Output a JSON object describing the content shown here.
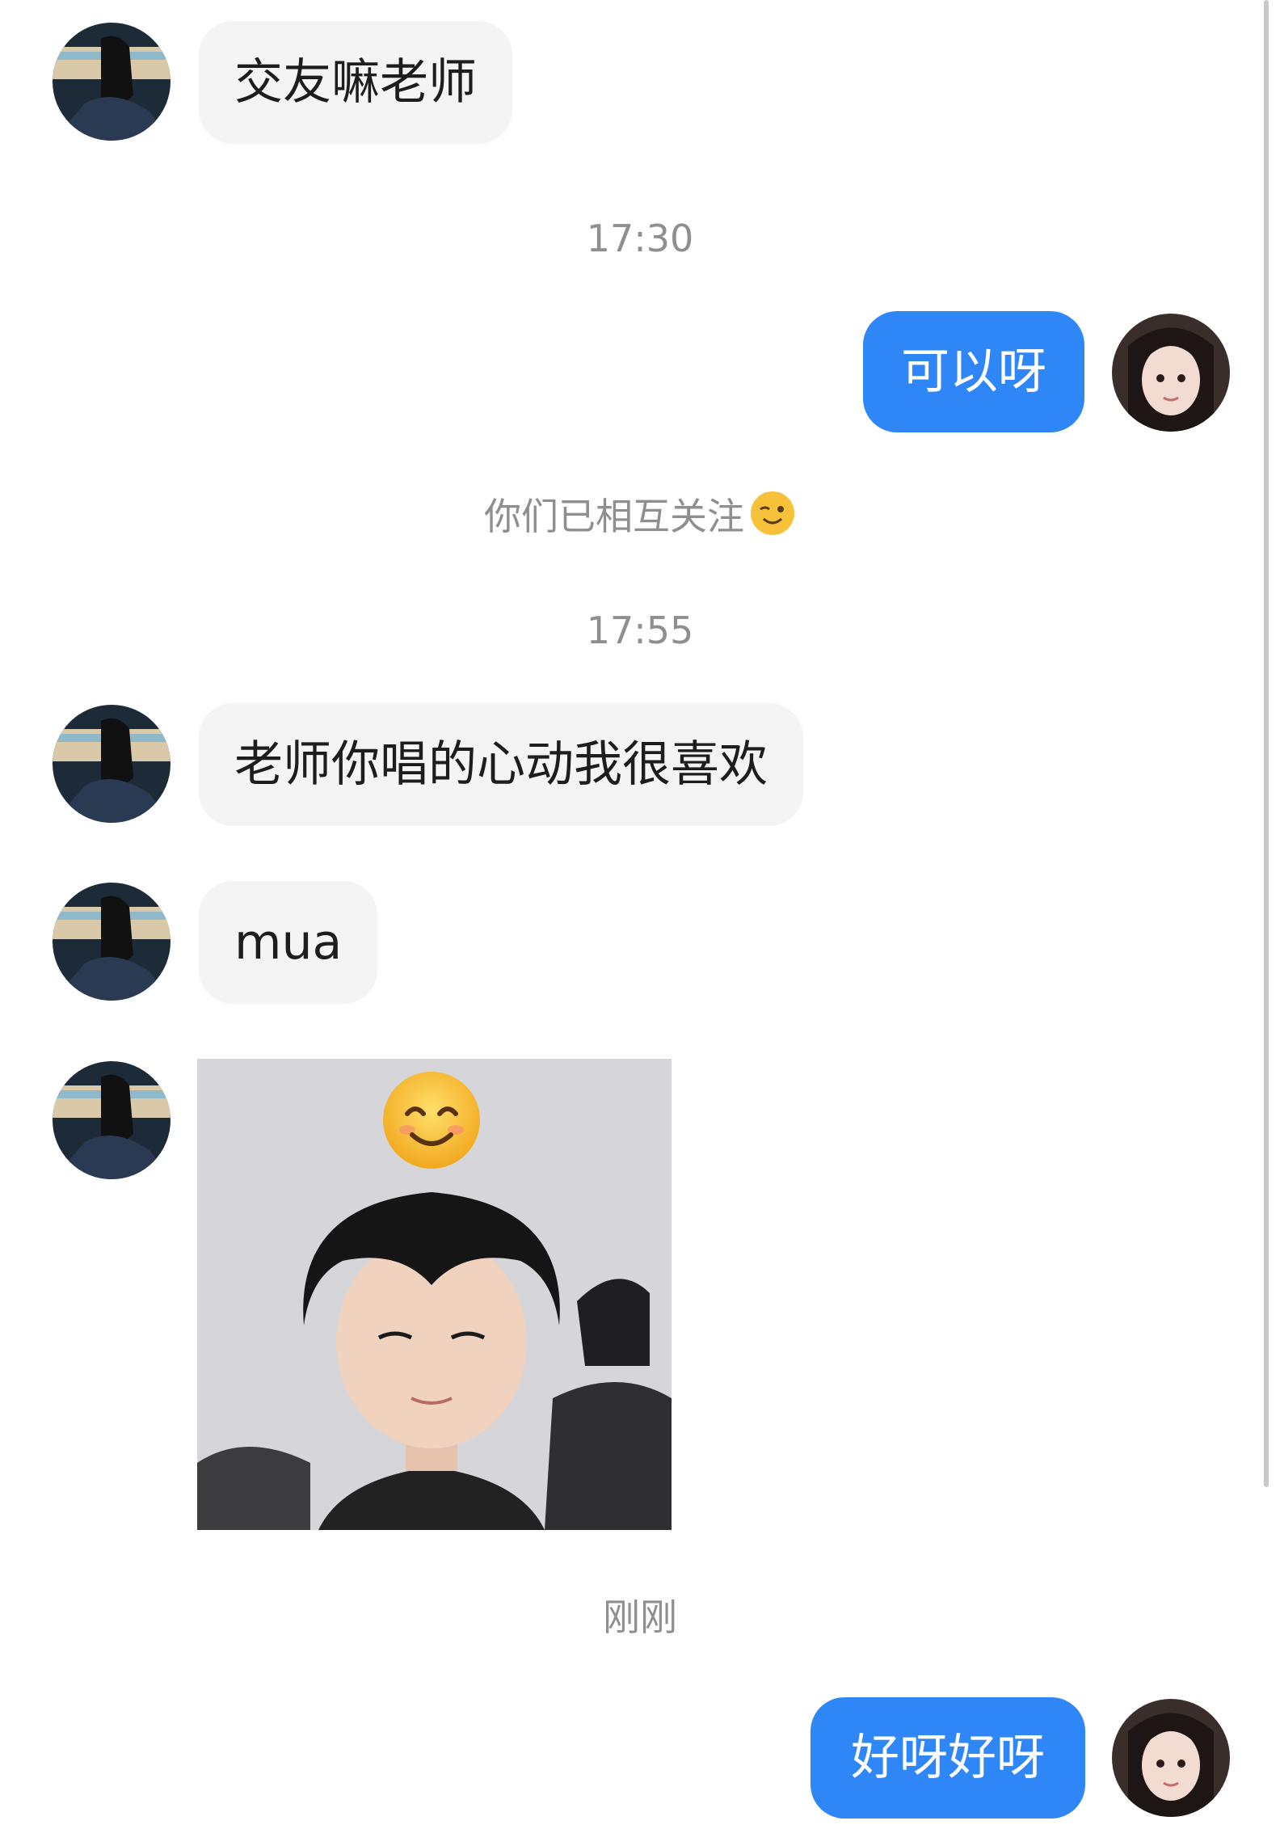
{
  "messages": {
    "m1_text": "交友嘛老师",
    "ts1": "17:30",
    "m2_text": "可以呀",
    "system_note": "你们已相互关注",
    "ts2": "17:55",
    "m3_text": "老师你唱的心动我很喜欢",
    "m4_text": "mua",
    "ts3": "刚刚",
    "m6_text": "好呀好呀"
  },
  "icons": {
    "note_emoji": "winking-face-icon",
    "sticker_emoji": "smiling-face-icon"
  },
  "colors": {
    "outgoing_bubble": "#2f86f6",
    "incoming_bubble": "#f4f4f4",
    "meta_text": "#8f8f8f"
  }
}
